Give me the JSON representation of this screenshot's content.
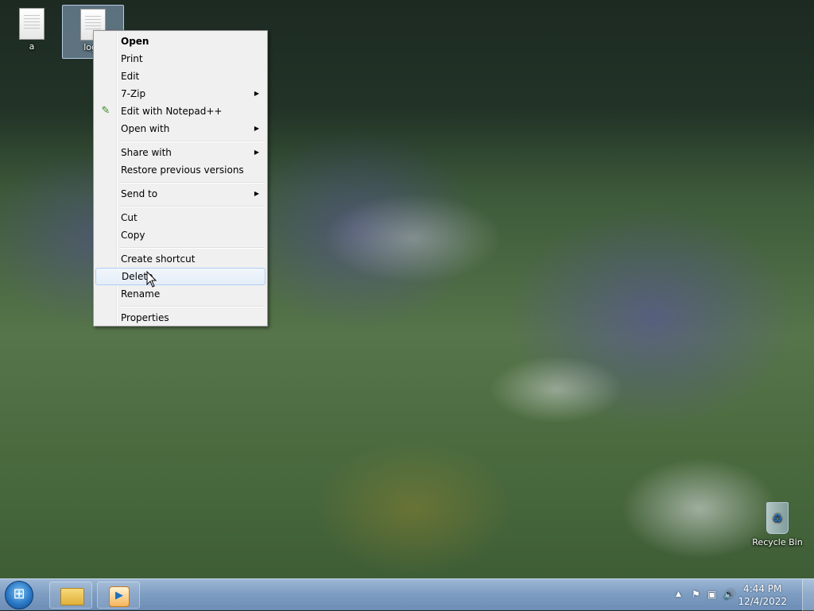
{
  "desktop": {
    "icons": [
      {
        "label": "a"
      },
      {
        "label": "logo"
      }
    ],
    "recycle_bin": {
      "label": "Recycle Bin"
    }
  },
  "context_menu": {
    "items": [
      {
        "label": "Open",
        "bold": true
      },
      {
        "label": "Print"
      },
      {
        "label": "Edit"
      },
      {
        "label": "7-Zip",
        "submenu": true
      },
      {
        "label": "Edit with Notepad++",
        "icon": "notepadpp-icon"
      },
      {
        "label": "Open with",
        "submenu": true
      },
      {
        "label": "Share with",
        "submenu": true
      },
      {
        "label": "Restore previous versions"
      },
      {
        "label": "Send to",
        "submenu": true
      },
      {
        "label": "Cut"
      },
      {
        "label": "Copy"
      },
      {
        "label": "Create shortcut"
      },
      {
        "label": "Delete",
        "highlighted": true
      },
      {
        "label": "Rename"
      },
      {
        "label": "Properties"
      }
    ],
    "submenu_arrow": "▶"
  },
  "taskbar": {
    "clock": {
      "time": "4:44 PM",
      "date": "12/4/2022"
    },
    "tray": {
      "show_hidden": "▲",
      "icons": [
        "action-center-icon",
        "network-icon",
        "volume-icon"
      ]
    },
    "pinned": [
      "windows-explorer",
      "windows-media-player"
    ]
  }
}
